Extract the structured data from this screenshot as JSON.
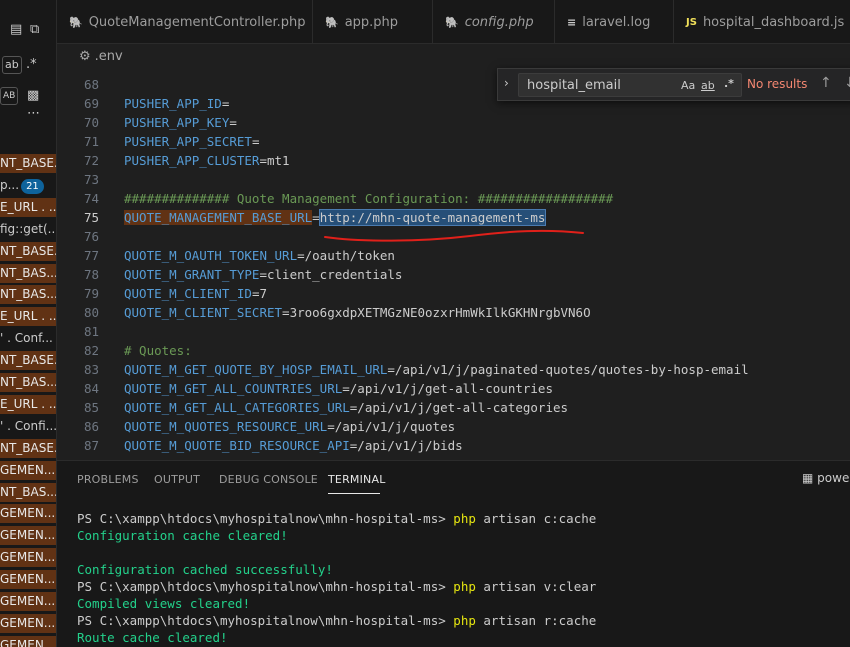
{
  "sidebar": {
    "find_label": "ab",
    "replace_label": "AB",
    "results_badge": "21",
    "items": [
      {
        "text": "NT_BASE...",
        "hl": true
      },
      {
        "text": "p...",
        "hl": false,
        "badge": "21"
      },
      {
        "text": "E_URL . ...",
        "hl": true
      },
      {
        "text": "fig::get(...",
        "hl": false
      },
      {
        "text": "NT_BASE...",
        "hl": true
      },
      {
        "text": "NT_BAS...",
        "hl": true
      },
      {
        "text": "NT_BAS...",
        "hl": true
      },
      {
        "text": "E_URL . ...",
        "hl": true
      },
      {
        "text": "' . Conf...",
        "hl": false
      },
      {
        "text": "NT_BASE...",
        "hl": true
      },
      {
        "text": "NT_BAS...",
        "hl": true
      },
      {
        "text": "E_URL . ...",
        "hl": true
      },
      {
        "text": "' . Confi...",
        "hl": false
      },
      {
        "text": "NT_BASE...",
        "hl": true
      },
      {
        "text": "GEMEN...",
        "hl": true
      },
      {
        "text": "NT_BAS...",
        "hl": true
      },
      {
        "text": "GEMEN...",
        "hl": true
      },
      {
        "text": "GEMEN...",
        "hl": true
      },
      {
        "text": "GEMEN...",
        "hl": true
      },
      {
        "text": "GEMEN...",
        "hl": true
      },
      {
        "text": "GEMEN...",
        "hl": true
      },
      {
        "text": "GEMEN...",
        "hl": true
      },
      {
        "text": "GEMEN...",
        "hl": true
      }
    ]
  },
  "tabs": [
    {
      "label": "QuoteManagementController.php",
      "icon": "php-icon",
      "italic": false
    },
    {
      "label": "app.php",
      "icon": "php-icon",
      "italic": false
    },
    {
      "label": "config.php",
      "icon": "php-icon",
      "italic": true
    },
    {
      "label": "laravel.log",
      "icon": "log-icon",
      "italic": false
    },
    {
      "label": "hospital_dashboard.js",
      "icon": "js-icon",
      "italic": false
    }
  ],
  "breadcrumb": ".env",
  "find": {
    "value": "hospital_email",
    "opt_case": "Aa",
    "opt_word": "ab",
    "opt_regex": ".*",
    "status": "No results"
  },
  "editor": {
    "lines": [
      {
        "n": "68",
        "key": "",
        "val": "",
        "type": "blank"
      },
      {
        "n": "69",
        "key": "PUSHER_APP_ID",
        "val": "=",
        "type": "kv"
      },
      {
        "n": "70",
        "key": "PUSHER_APP_KEY",
        "val": "=",
        "type": "kv"
      },
      {
        "n": "71",
        "key": "PUSHER_APP_SECRET",
        "val": "=",
        "type": "kv"
      },
      {
        "n": "72",
        "key": "PUSHER_APP_CLUSTER",
        "val": "=mt1",
        "type": "kv"
      },
      {
        "n": "73",
        "key": "",
        "val": "",
        "type": "blank"
      },
      {
        "n": "74",
        "key": "",
        "val": "############## Quote Management Configuration: ##################",
        "type": "comment"
      },
      {
        "n": "75",
        "key": "QUOTE_MANAGEMENT_BASE_URL",
        "val": "http://mhn-quote-management-ms",
        "type": "kvsel"
      },
      {
        "n": "76",
        "key": "",
        "val": "",
        "type": "blank"
      },
      {
        "n": "77",
        "key": "QUOTE_M_OAUTH_TOKEN_URL",
        "val": "=/oauth/token",
        "type": "kv"
      },
      {
        "n": "78",
        "key": "QUOTE_M_GRANT_TYPE",
        "val": "=client_credentials",
        "type": "kv"
      },
      {
        "n": "79",
        "key": "QUOTE_M_CLIENT_ID",
        "val": "=7",
        "type": "kv"
      },
      {
        "n": "80",
        "key": "QUOTE_M_CLIENT_SECRET",
        "val": "=3roo6gxdpXETMGzNE0ozxrHmWkIlkGKHNrgbVN6O",
        "type": "kv"
      },
      {
        "n": "81",
        "key": "",
        "val": "",
        "type": "blank"
      },
      {
        "n": "82",
        "key": "",
        "val": "# Quotes:",
        "type": "comment"
      },
      {
        "n": "83",
        "key": "QUOTE_M_GET_QUOTE_BY_HOSP_EMAIL_URL",
        "val": "=/api/v1/j/paginated-quotes/quotes-by-hosp-email",
        "type": "kv"
      },
      {
        "n": "84",
        "key": "QUOTE_M_GET_ALL_COUNTRIES_URL",
        "val": "=/api/v1/j/get-all-countries",
        "type": "kv"
      },
      {
        "n": "85",
        "key": "QUOTE_M_GET_ALL_CATEGORIES_URL",
        "val": "=/api/v1/j/get-all-categories",
        "type": "kv"
      },
      {
        "n": "86",
        "key": "QUOTE_M_QUOTES_RESOURCE_URL",
        "val": "=/api/v1/j/quotes",
        "type": "kv"
      },
      {
        "n": "87",
        "key": "QUOTE_M_QUOTE_BID_RESOURCE_API",
        "val": "=/api/v1/j/bids",
        "type": "kv"
      }
    ],
    "active_line": "75"
  },
  "panel": {
    "tabs": [
      "PROBLEMS",
      "OUTPUT",
      "DEBUG CONSOLE",
      "TERMINAL"
    ],
    "active_tab": "TERMINAL",
    "shell_label": "power",
    "terminal": [
      {
        "type": "cmd",
        "prompt": "PS C:\\xampp\\htdocs\\myhospitalnow\\mhn-hospital-ms> ",
        "php": "php",
        "rest": " artisan c:cache"
      },
      {
        "type": "ok",
        "text": "Configuration cache cleared!"
      },
      {
        "type": "blank",
        "text": ""
      },
      {
        "type": "ok",
        "text": "Configuration cached successfully!"
      },
      {
        "type": "cmd",
        "prompt": "PS C:\\xampp\\htdocs\\myhospitalnow\\mhn-hospital-ms> ",
        "php": "php",
        "rest": " artisan v:clear"
      },
      {
        "type": "ok",
        "text": "Compiled views cleared!"
      },
      {
        "type": "cmd",
        "prompt": "PS C:\\xampp\\htdocs\\myhospitalnow\\mhn-hospital-ms> ",
        "php": "php",
        "rest": " artisan r:cache"
      },
      {
        "type": "ok",
        "text": "Route cache cleared!"
      }
    ]
  },
  "colors": {
    "annotation": "#e0201a",
    "selection": "#264f78",
    "match_highlight": "#613214",
    "keyword": "#569cd6",
    "comment": "#6a9955",
    "terminal_ok": "#23d18b",
    "terminal_php": "#e5e510"
  }
}
